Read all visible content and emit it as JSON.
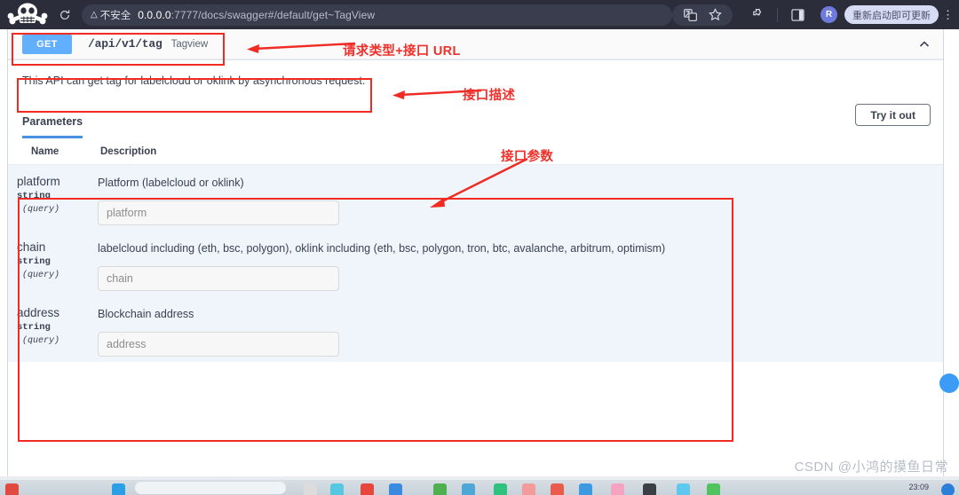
{
  "browser": {
    "logo_icon": "skull-logo",
    "reload_icon": "reload-icon",
    "security_icon": "warning-triangle-icon",
    "security_label": "不安全",
    "url_host": "0.0.0.0",
    "url_rest": ":7777/docs/swagger#/default/get~TagView",
    "url_full": "0.0.0.0:7777/docs/swagger#/default/get~TagView",
    "translate_icon": "translate-icon",
    "bookmark_icon": "star-icon",
    "extensions_icon": "extensions-puzzle-icon",
    "sidepanel_icon": "side-panel-icon",
    "profile_initial": "R",
    "update_pill_label": "重新启动即可更新",
    "menu_icon": "kebab-menu-icon"
  },
  "operation": {
    "method": "GET",
    "path": "/api/v1/tag",
    "summary": "Tagview",
    "collapse_icon": "chevron-up-icon",
    "description": "This API can get tag for labelcloud or oklink by asynchronous request."
  },
  "params_panel": {
    "tab_label": "Parameters",
    "try_it_out_label": "Try it out",
    "col_name": "Name",
    "col_description": "Description",
    "rows": [
      {
        "name": "platform",
        "type": "string",
        "in": "(query)",
        "description": "Platform (labelcloud or oklink)",
        "value": "",
        "placeholder": "platform"
      },
      {
        "name": "chain",
        "type": "string",
        "in": "(query)",
        "description": "labelcloud including (eth, bsc, polygon), oklink including (eth, bsc, polygon, tron, btc, avalanche, arbitrum, optimism)",
        "value": "",
        "placeholder": "chain"
      },
      {
        "name": "address",
        "type": "string",
        "in": "(query)",
        "description": "Blockchain address",
        "value": "",
        "placeholder": "address"
      }
    ]
  },
  "annotations": [
    {
      "id": "method-url",
      "text": "请求类型+接口 URL"
    },
    {
      "id": "description",
      "text": "接口描述"
    },
    {
      "id": "parameters",
      "text": "接口参数"
    }
  ],
  "watermark": "CSDN @小鸿的摸鱼日常",
  "taskbar": {
    "clock": "23:09"
  },
  "colors": {
    "get_badge": "#61affe",
    "annotation_red": "#f0302a",
    "tab_underline": "#4990e2",
    "param_bg": "#eff5fb",
    "chrome_bg": "#2b2d3b"
  }
}
